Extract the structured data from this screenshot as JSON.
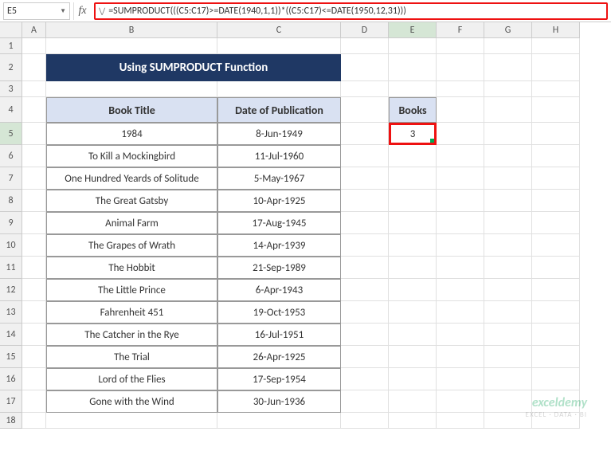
{
  "namebox": {
    "value": "E5"
  },
  "formula_bar": {
    "text": "=SUMPRODUCT(((C5:C17)>=DATE(1940,1,1))*((C5:C17)<=DATE(1950,12,31)))"
  },
  "columns": [
    "A",
    "B",
    "C",
    "D",
    "E",
    "F",
    "G",
    "H"
  ],
  "active_column": "E",
  "active_row": "5",
  "row_labels": [
    "1",
    "2",
    "3",
    "4",
    "5",
    "6",
    "7",
    "8",
    "9",
    "10",
    "11",
    "12",
    "13",
    "14",
    "15",
    "16",
    "17",
    "18"
  ],
  "title_banner": "Using SUMPRODUCT Function",
  "table": {
    "headers": {
      "book": "Book Title",
      "date": "Date of Publication"
    },
    "rows": [
      {
        "book": "1984",
        "date": "8-Jun-1949"
      },
      {
        "book": "To Kill a Mockingbird",
        "date": "11-Jul-1960"
      },
      {
        "book": "One Hundred Yeards of Solitude",
        "date": "5-May-1967"
      },
      {
        "book": "The Great Gatsby",
        "date": "10-Apr-1925"
      },
      {
        "book": "Animal Farm",
        "date": "17-Aug-1945"
      },
      {
        "book": "The Grapes of Wrath",
        "date": "14-Apr-1939"
      },
      {
        "book": "The Hobbit",
        "date": "21-Sep-1989"
      },
      {
        "book": "The Little Prince",
        "date": "6-Apr-1943"
      },
      {
        "book": "Fahrenheit 451",
        "date": "19-Oct-1953"
      },
      {
        "book": "The Catcher in the Rye",
        "date": "16-Jul-1951"
      },
      {
        "book": "The Trial",
        "date": "26-Apr-1925"
      },
      {
        "book": "Lord of the Flies",
        "date": "17-Sep-1954"
      },
      {
        "book": "Gone with the Wind",
        "date": "30-Jun-1936"
      }
    ]
  },
  "result": {
    "header": "Books",
    "value": "3"
  },
  "watermark": {
    "line1": "exceldemy",
    "line2": "EXCEL · DATA · BI"
  }
}
